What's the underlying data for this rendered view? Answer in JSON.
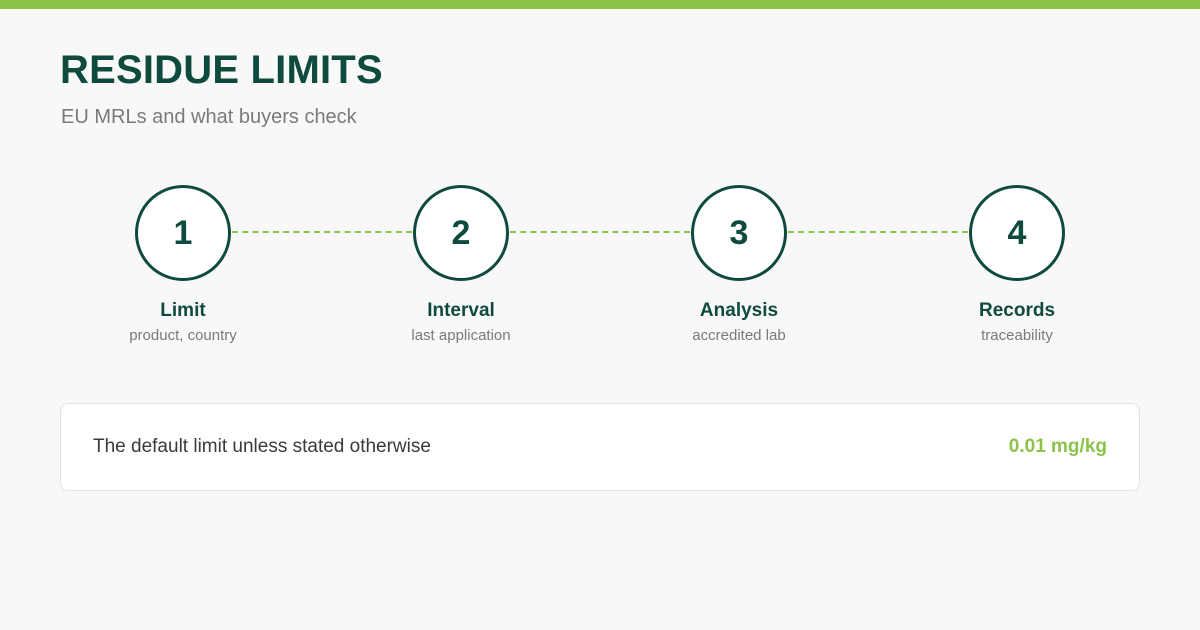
{
  "header": {
    "title": "RESIDUE LIMITS",
    "subtitle": "EU MRLs and what buyers check"
  },
  "steps": [
    {
      "number": "1",
      "label": "Limit",
      "sub": "product, country"
    },
    {
      "number": "2",
      "label": "Interval",
      "sub": "last application"
    },
    {
      "number": "3",
      "label": "Analysis",
      "sub": "accredited lab"
    },
    {
      "number": "4",
      "label": "Records",
      "sub": "traceability"
    }
  ],
  "info": {
    "text": "The default limit unless stated otherwise",
    "value": "0.01 mg/kg"
  },
  "colors": {
    "accent": "#8bc34a",
    "primary": "#0e4a3e",
    "background": "#f8f8f8"
  }
}
